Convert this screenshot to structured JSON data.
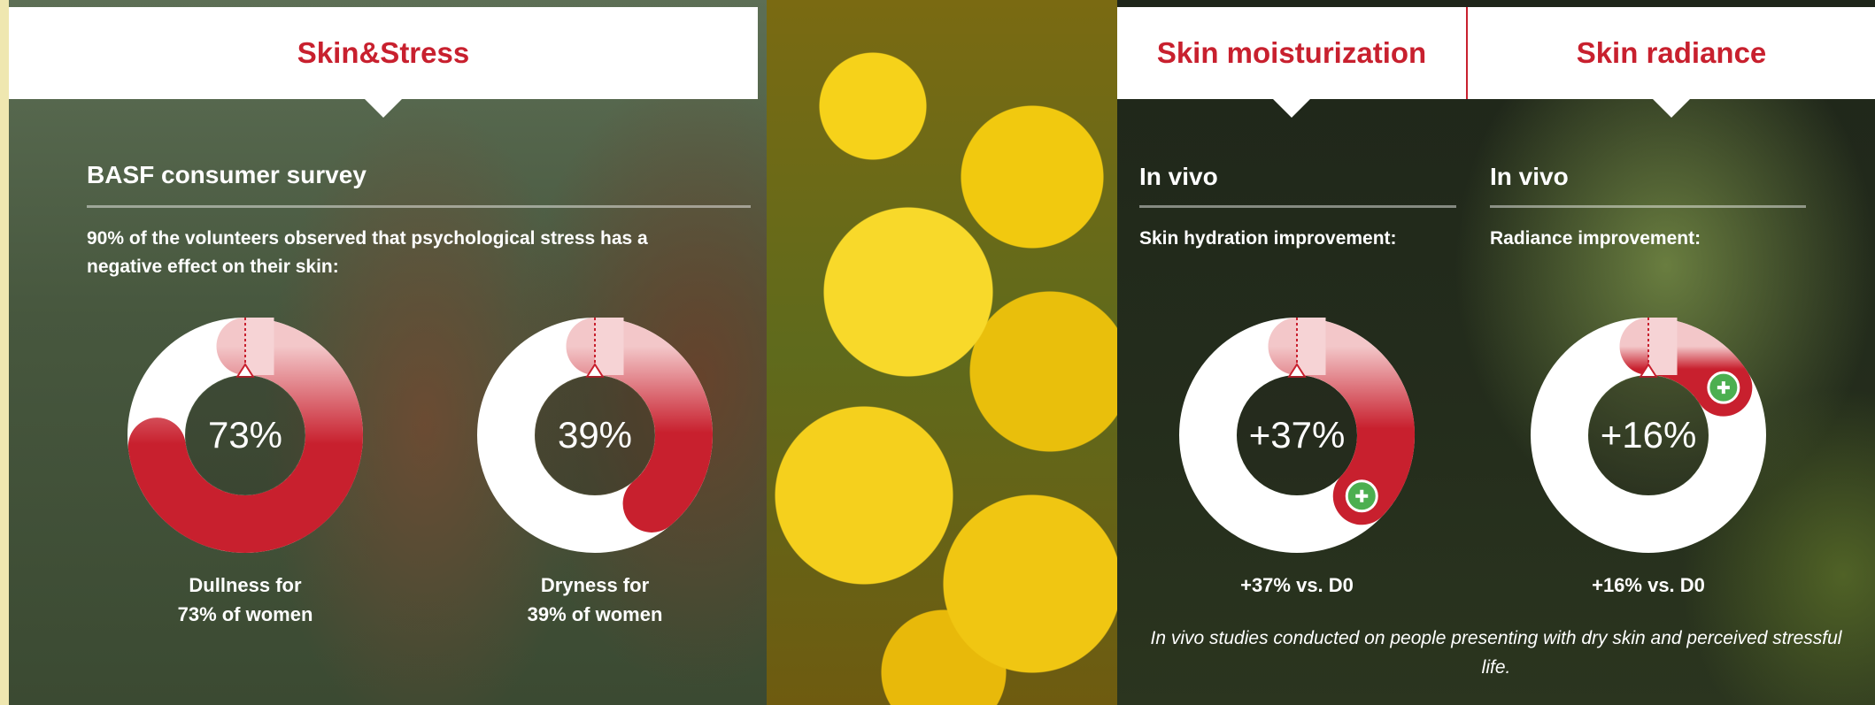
{
  "tabs": {
    "stress": "Skin&Stress",
    "moisturization": "Skin moisturization",
    "radiance": "Skin radiance"
  },
  "survey": {
    "title": "BASF consumer survey",
    "description": "90% of the volunteers observed that psychological stress has a negative effect on their skin:"
  },
  "moist": {
    "title": "In vivo",
    "subtitle": "Skin hydration improvement:",
    "caption": "+37% vs. D0"
  },
  "radiance": {
    "title": "In vivo",
    "subtitle": "Radiance improvement:",
    "caption": "+16% vs. D0"
  },
  "footnote": "In vivo studies conducted on people presenting with dry skin and perceived stressful life.",
  "colors": {
    "accent_red": "#c8202e",
    "plus_green": "#4caf50"
  },
  "chart_data": [
    {
      "type": "pie",
      "id": "dullness",
      "value_percent": 73,
      "center_label": "73%",
      "caption_line1": "Dullness for",
      "caption_line2": "73% of women"
    },
    {
      "type": "pie",
      "id": "dryness",
      "value_percent": 39,
      "center_label": "39%",
      "caption_line1": "Dryness for",
      "caption_line2": "39% of women"
    },
    {
      "type": "pie",
      "id": "hydration",
      "value_percent": 37,
      "center_label": "+37%",
      "plus_marker": true
    },
    {
      "type": "pie",
      "id": "radiance",
      "value_percent": 16,
      "center_label": "+16%",
      "plus_marker": true
    }
  ]
}
